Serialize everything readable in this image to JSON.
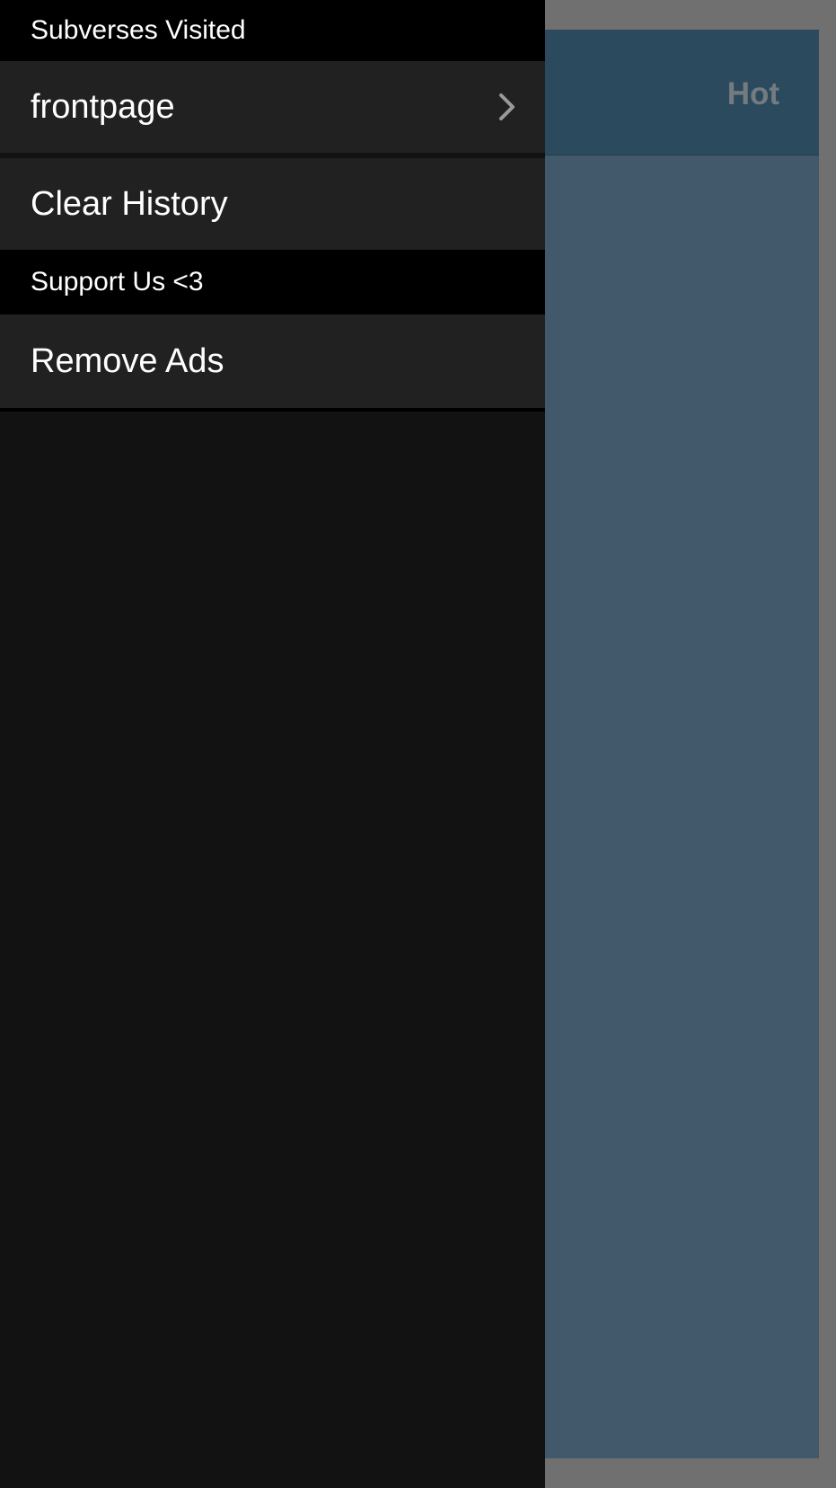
{
  "background": {
    "sort_label": "Hot"
  },
  "drawer": {
    "sections": [
      {
        "header": "Subverses Visited",
        "items": [
          {
            "label": "frontpage",
            "icon": "chevron-right-icon"
          }
        ]
      },
      {
        "items": [
          {
            "label": "Clear History"
          }
        ]
      },
      {
        "header": "Support Us <3",
        "items": [
          {
            "label": "Remove Ads"
          }
        ]
      }
    ]
  },
  "colors": {
    "drawer_bg": "#121212",
    "cell_bg": "#212121",
    "header_bg": "#000000",
    "content_bg": "#41596a",
    "navbar_bg": "#2c4a5e"
  }
}
